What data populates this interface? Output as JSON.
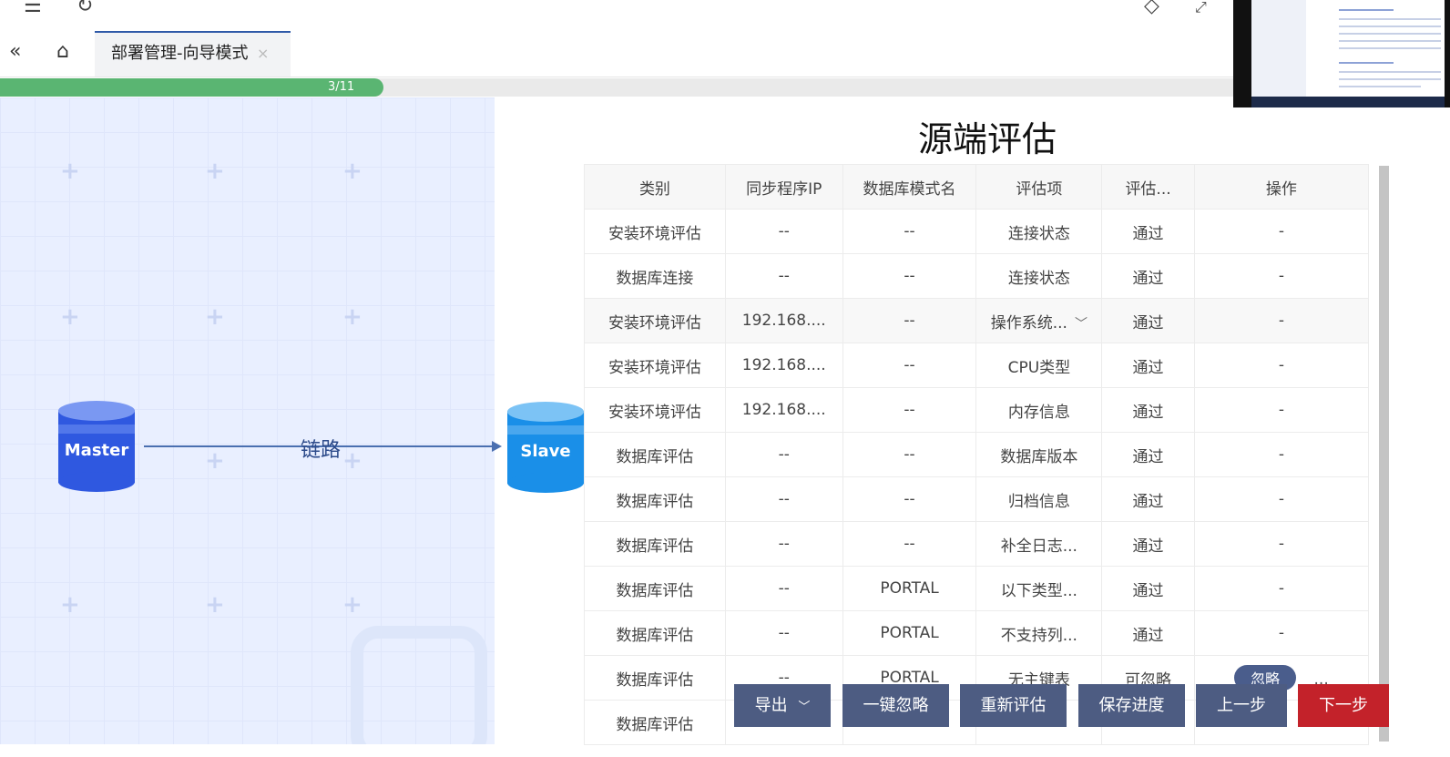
{
  "tabbar": {
    "active_tab": "部署管理-向导模式",
    "close": "×"
  },
  "progress": {
    "text": "3/11",
    "fraction": 0.2727
  },
  "topology": {
    "source_label": "Master",
    "target_label": "Slave",
    "link_label": "链路"
  },
  "main": {
    "title": "源端评估",
    "columns": [
      "类别",
      "同步程序IP",
      "数据库模式名",
      "评估项",
      "评估...",
      "操作"
    ],
    "rows": [
      [
        "安装环境评估",
        "--",
        "--",
        "连接状态",
        "通过",
        "-"
      ],
      [
        "数据库连接",
        "--",
        "--",
        "连接状态",
        "通过",
        "-"
      ],
      [
        "安装环境评估",
        "192.168....",
        "--",
        "操作系统...",
        "通过",
        "-"
      ],
      [
        "安装环境评估",
        "192.168....",
        "--",
        "CPU类型",
        "通过",
        "-"
      ],
      [
        "安装环境评估",
        "192.168....",
        "--",
        "内存信息",
        "通过",
        "-"
      ],
      [
        "数据库评估",
        "--",
        "--",
        "数据库版本",
        "通过",
        "-"
      ],
      [
        "数据库评估",
        "--",
        "--",
        "归档信息",
        "通过",
        "-"
      ],
      [
        "数据库评估",
        "--",
        "--",
        "补全日志...",
        "通过",
        "-"
      ],
      [
        "数据库评估",
        "--",
        "PORTAL",
        "以下类型...",
        "通过",
        "-"
      ],
      [
        "数据库评估",
        "--",
        "PORTAL",
        "不支持列...",
        "通过",
        "-"
      ],
      [
        "数据库评估",
        "--",
        "PORTAL",
        "无主键表",
        "可忽略",
        ""
      ],
      [
        "数据库评估",
        "",
        "",
        "",
        "",
        ""
      ]
    ],
    "ignore_label": "忽略",
    "more_label": "..."
  },
  "buttons": {
    "export": "导出",
    "ignore_all": "一键忽略",
    "reassess": "重新评估",
    "save": "保存进度",
    "prev": "上一步",
    "next": "下一步"
  },
  "colors": {
    "progress": "#5ab572",
    "button": "#4d5c82",
    "next_button": "#c3222a"
  }
}
